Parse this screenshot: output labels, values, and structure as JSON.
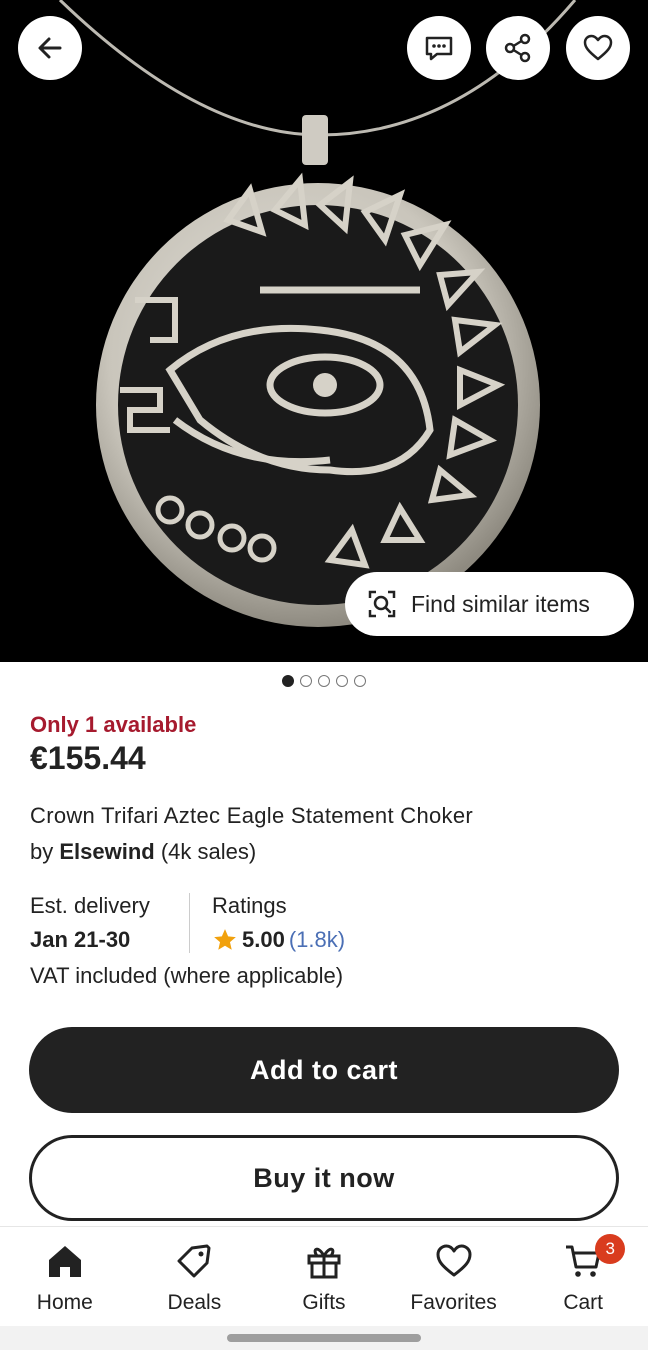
{
  "header": {
    "back_icon": "arrow-left-icon",
    "actions": [
      "message-icon",
      "share-icon",
      "heart-icon"
    ]
  },
  "image": {
    "find_similar_label": "Find similar items",
    "carousel_count": 5,
    "carousel_active": 0
  },
  "product": {
    "availability": "Only 1 available",
    "price": "€155.44",
    "title": "Crown Trifari Aztec Eagle Statement Choker",
    "seller_prefix": "by ",
    "seller_name": "Elsewind",
    "seller_sales": " (4k sales)",
    "delivery_label": "Est. delivery",
    "delivery_value": "Jan 21-30",
    "ratings_label": "Ratings",
    "rating_value": "5.00",
    "rating_count": "(1.8k)",
    "vat_note": "VAT included (where applicable)"
  },
  "actions": {
    "add_to_cart": "Add to cart",
    "buy_now": "Buy it now"
  },
  "nav": {
    "items": [
      {
        "label": "Home",
        "icon": "home-icon"
      },
      {
        "label": "Deals",
        "icon": "tag-icon"
      },
      {
        "label": "Gifts",
        "icon": "gift-icon"
      },
      {
        "label": "Favorites",
        "icon": "heart-icon"
      },
      {
        "label": "Cart",
        "icon": "cart-icon"
      }
    ],
    "cart_badge": "3"
  },
  "colors": {
    "accent_red": "#a61a2e",
    "link_blue": "#4b6fb5",
    "star": "#f1a10d",
    "badge": "#d93c1e",
    "dark": "#222222"
  }
}
